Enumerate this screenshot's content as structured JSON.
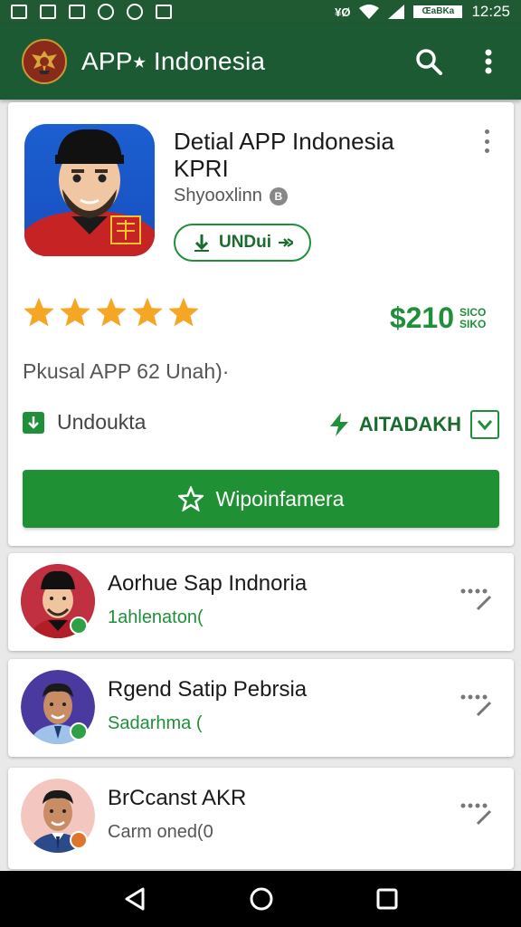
{
  "status_bar": {
    "time": "12:25",
    "network": "¥Ø",
    "battery_label": "ŒaBKa",
    "icons": [
      "image-icon",
      "tablet-icon",
      "photo-icon",
      "target-icon",
      "whatsapp-icon",
      "shield-icon"
    ]
  },
  "app_bar": {
    "title": "APP⭑ Indonesia",
    "logo_icon": "garuda-emblem",
    "search_icon": "search-icon",
    "menu_icon": "more-vert-icon"
  },
  "detail": {
    "title": "Detial APP Indonesia KPRI",
    "developer": "Shyooxlinn",
    "developer_badge": "B",
    "download_pill": "UNDui",
    "rating_stars": 5,
    "price": "$210",
    "price_sub": "SICO SIKO",
    "subtitle": "Pkusal APP 62 Unah)·",
    "download_label": "Undoukta",
    "tag_label": "AITADAKH",
    "primary_button": "Wipoinfamera"
  },
  "list": [
    {
      "name": "Aorhue Sap Indnoria",
      "sub": "1ahlenaton(",
      "badge_color": "#2fa045",
      "sub_color": "#1f8f3a"
    },
    {
      "name": "Rgend Satip Pebrsia",
      "sub": "Sadarhma (",
      "badge_color": "#2fa045",
      "sub_color": "#1f8f3a"
    },
    {
      "name": "BrCcanst AKR",
      "sub": "Carm oned(0",
      "badge_color": "#e0742a",
      "sub_color": "#555555"
    }
  ],
  "colors": {
    "primary_dark": "#1b5a32",
    "accent_green": "#1f9033",
    "star": "#f5a623"
  }
}
